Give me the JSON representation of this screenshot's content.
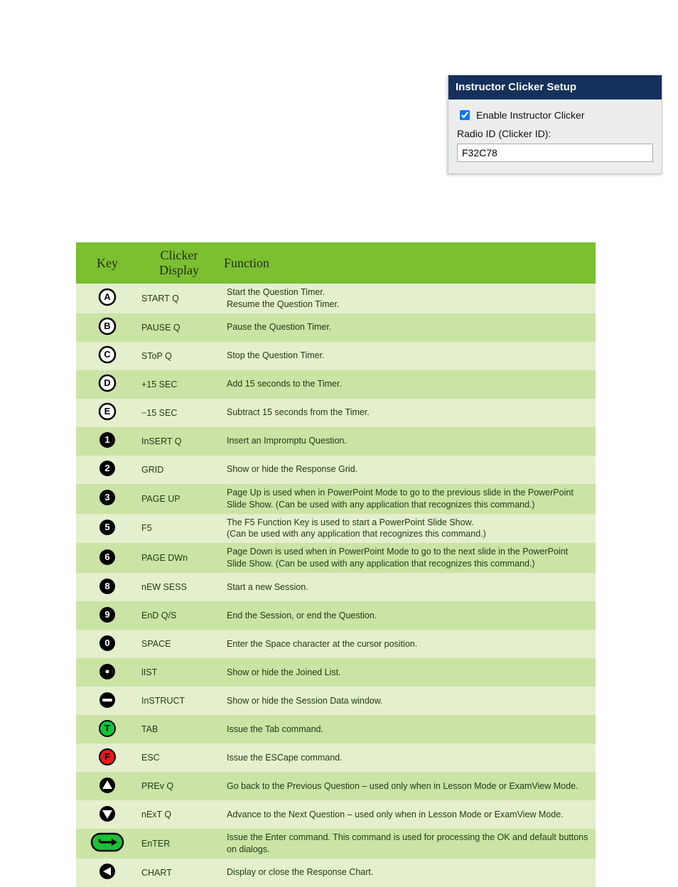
{
  "setup": {
    "title": "Instructor Clicker Setup",
    "enable_label": "Enable Instructor Clicker",
    "enable_checked": true,
    "radio_label": "Radio ID (Clicker ID):",
    "radio_value": "F32C78"
  },
  "table": {
    "headers": {
      "key": "Key",
      "display": "Clicker\nDisplay",
      "func": "Function"
    },
    "rows": [
      {
        "icon": "ring-A",
        "display": "START Q",
        "func": "Start the Question Timer.\nResume the Question Timer."
      },
      {
        "icon": "ring-B",
        "display": "PAUSE Q",
        "func": "Pause the Question Timer."
      },
      {
        "icon": "ring-C",
        "display": "SToP Q",
        "func": "Stop the Question Timer."
      },
      {
        "icon": "ring-D",
        "display": "+15 SEC",
        "func": "Add 15 seconds to the Timer."
      },
      {
        "icon": "ring-E",
        "display": "−15 SEC",
        "func": "Subtract 15 seconds from the Timer."
      },
      {
        "icon": "solid-1",
        "display": "InSERT Q",
        "func": "Insert an Impromptu Question."
      },
      {
        "icon": "solid-2",
        "display": "GRID",
        "func": "Show or hide the Response Grid."
      },
      {
        "icon": "solid-3",
        "display": "PAGE UP",
        "func": "Page Up is used when in PowerPoint Mode to go to the previous slide in the PowerPoint Slide Show. (Can be used with any application that recognizes this command.)"
      },
      {
        "icon": "solid-5",
        "display": "F5",
        "func": "The F5 Function Key is used to start a PowerPoint Slide Show.\n(Can be used with any application that recognizes this command.)"
      },
      {
        "icon": "solid-6",
        "display": "PAGE DWn",
        "func": "Page Down is used when in PowerPoint Mode to go to the next slide in the PowerPoint Slide Show. (Can be used with any application that recognizes this command.)"
      },
      {
        "icon": "solid-8",
        "display": "nEW SESS",
        "func": "Start a new Session."
      },
      {
        "icon": "solid-9",
        "display": "EnD Q/S",
        "func": "End the Session, or end the Question."
      },
      {
        "icon": "solid-0",
        "display": "SPACE",
        "func": "Enter the Space character at the cursor position."
      },
      {
        "icon": "dot",
        "display": "lIST",
        "func": "Show or hide the Joined List."
      },
      {
        "icon": "minus",
        "display": "InSTRUCT",
        "func": "Show or hide the Session Data window."
      },
      {
        "icon": "green-T",
        "display": "TAB",
        "func": "Issue the Tab command."
      },
      {
        "icon": "red-F",
        "display": "ESC",
        "func": "Issue the ESCape command."
      },
      {
        "icon": "arrow-up",
        "display": "PREv Q",
        "func": "Go back to the Previous Question – used only when in Lesson Mode or ExamView Mode."
      },
      {
        "icon": "arrow-dn",
        "display": "nExT Q",
        "func": "Advance to the Next Question – used only when in Lesson Mode or ExamView Mode."
      },
      {
        "icon": "enter",
        "display": "EnTER",
        "func": "Issue the Enter command. This command is used for processing the OK and default buttons on dialogs."
      },
      {
        "icon": "chart",
        "display": "CHART",
        "func": "Display or close the Response Chart."
      }
    ]
  }
}
